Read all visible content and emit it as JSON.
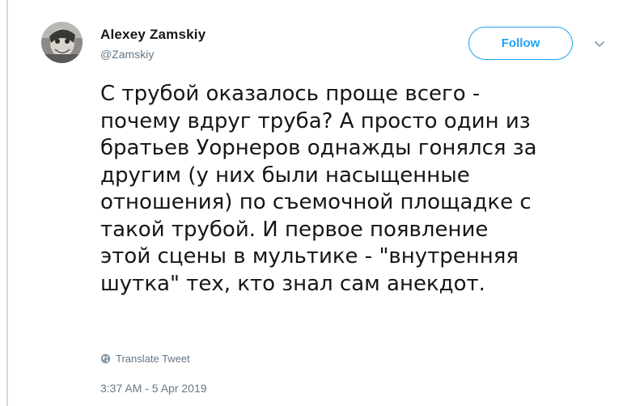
{
  "author": {
    "display_name": "Alexey Zamskiy",
    "handle": "@Zamskiy"
  },
  "follow_label": "Follow",
  "tweet": {
    "lines": [
      "С трубой оказалось проще всего -",
      "почему вдруг труба? А просто один из",
      "братьев Уорнеров однажды гонялся за",
      "другим (у них были насыщенные",
      "отношения) по съемочной площадке с",
      "такой трубой. И первое появление",
      "этой сцены в мультике - \"внутренняя",
      "шутка\" тех, кто знал сам анекдот."
    ]
  },
  "translate_label": "Translate Tweet",
  "timestamp": "3:37 AM - 5 Apr 2019",
  "icons": {
    "caret": "chevron-down-icon",
    "globe": "globe-icon"
  },
  "colors": {
    "accent": "#1da1f2",
    "text": "#14171a",
    "muted": "#657786"
  }
}
